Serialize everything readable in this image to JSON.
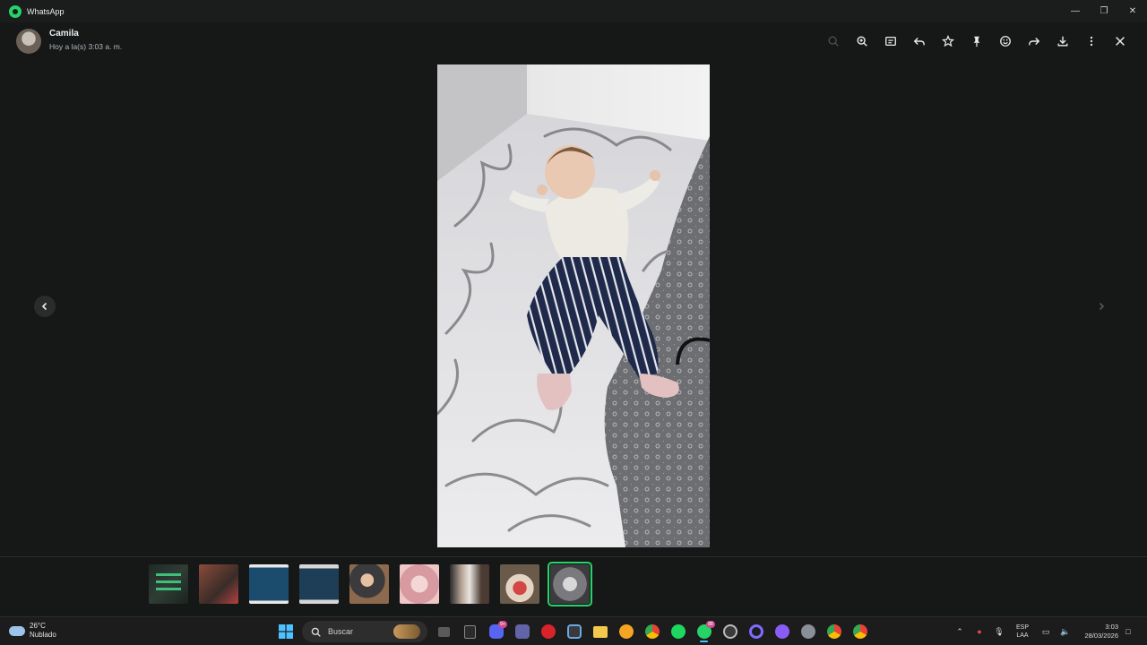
{
  "window": {
    "title": "WhatsApp"
  },
  "header": {
    "contact_name": "Camila",
    "timestamp": "Hoy a la(s) 3:03 a. m."
  },
  "toolbar": {
    "icons": [
      "search-icon",
      "zoom-in-icon",
      "caption-icon",
      "reply-icon",
      "star-icon",
      "pin-icon",
      "emoji-icon",
      "forward-icon",
      "download-icon",
      "more-icon",
      "close-icon"
    ]
  },
  "viewer": {
    "media": "photo of a sleeping toddler on a patterned bed sheet"
  },
  "thumbnails": {
    "count": 9,
    "active_index": 8
  },
  "taskbar": {
    "weather": {
      "temp": "26°C",
      "condition": "Nublado"
    },
    "search_placeholder": "Buscar",
    "discord_badge": "9+",
    "whatsapp_badge": "88",
    "lang": {
      "line1": "ESP",
      "line2": "LAA"
    },
    "clock": {
      "time": "3:03",
      "date": "28/03/2026"
    }
  },
  "colors": {
    "accent": "#25d366",
    "background": "#161717"
  }
}
